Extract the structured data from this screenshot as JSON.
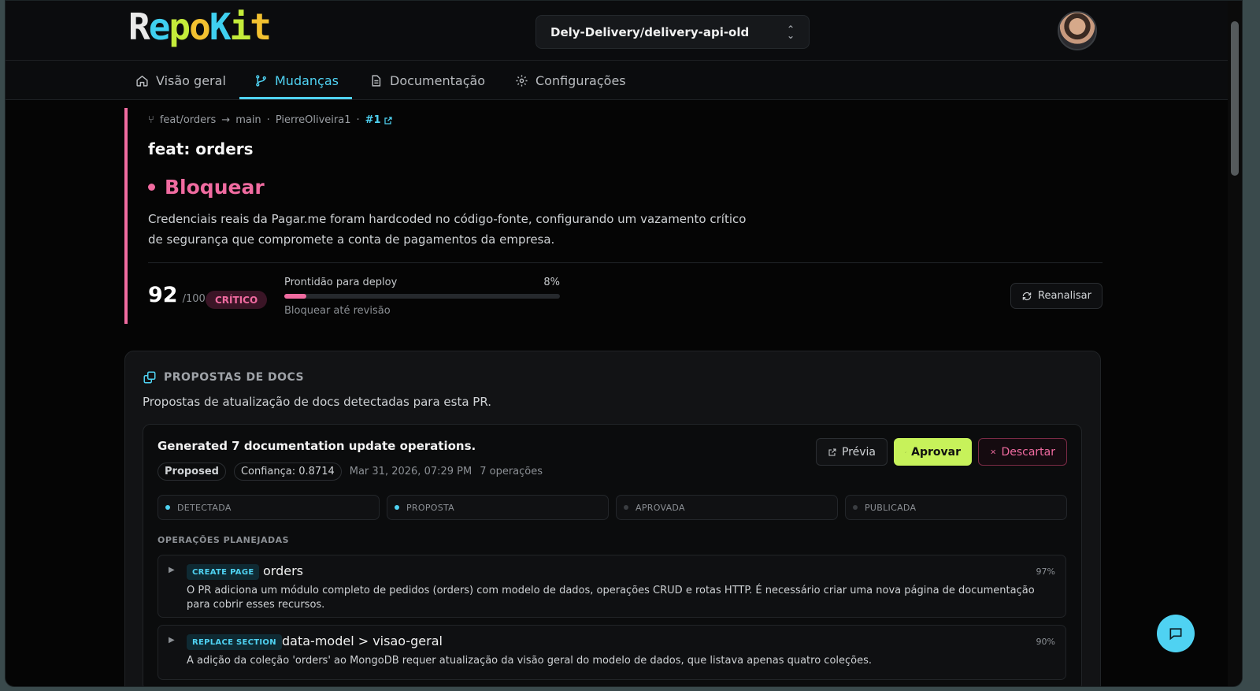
{
  "app": {
    "logo_text": "RepoKit"
  },
  "header": {
    "repo_selector": "Dely-Delivery/delivery-api-old"
  },
  "tabs": [
    {
      "label": "Visão geral",
      "icon": "home-icon"
    },
    {
      "label": "Mudanças",
      "icon": "git-branch-icon",
      "active": true
    },
    {
      "label": "Documentação",
      "icon": "document-icon"
    },
    {
      "label": "Configurações",
      "icon": "gear-icon"
    }
  ],
  "pr": {
    "source_branch": "feat/orders",
    "target_branch": "main",
    "author": "PierreOliveira1",
    "number": "#1",
    "title": "feat: orders",
    "verdict": "Bloquear",
    "verdict_description": "Credenciais reais da Pagar.me foram hardcoded no código-fonte, configurando um vazamento crítico de segurança que compromete a conta de pagamentos da empresa.",
    "score": "92",
    "score_max": "/100",
    "severity": "CRÍTICO",
    "deploy_label": "Prontidão para deploy",
    "deploy_percent": "8%",
    "deploy_fraction": 0.08,
    "deploy_note": "Bloquear até revisão",
    "reanalyze_label": "Reanalisar",
    "accent_color": "#f06ba0"
  },
  "docs": {
    "heading": "PROPOSTAS DE DOCS",
    "subtitle": "Propostas de atualização de docs detectadas para esta PR.",
    "operation": {
      "title": "Generated 7 documentation update operations.",
      "status": "Proposed",
      "confidence": "Confiança: 0.8714",
      "timestamp": "Mar 31, 2026, 07:29 PM",
      "count": "7 operações",
      "preview_label": "Prévia",
      "approve_label": "Aprovar",
      "discard_label": "Descartar"
    },
    "stages": [
      {
        "label": "DETECTADA",
        "done": true
      },
      {
        "label": "PROPOSTA",
        "done": true
      },
      {
        "label": "APROVADA",
        "done": false
      },
      {
        "label": "PUBLICADA",
        "done": false
      }
    ],
    "planned_heading": "OPERAÇÕES PLANEJADAS",
    "planned_ops": [
      {
        "tag": "CREATE PAGE",
        "name": "orders",
        "percent": "97%",
        "description": "O PR adiciona um módulo completo de pedidos (orders) com modelo de dados, operações CRUD e rotas HTTP. É necessário criar uma nova página de documentação para cobrir esses recursos."
      },
      {
        "tag": "REPLACE SECTION",
        "name": "data-model > visao-geral",
        "percent": "90%",
        "description": "A adição da coleção 'orders' ao MongoDB requer atualização da visão geral do modelo de dados, que listava apenas quatro coleções."
      }
    ]
  },
  "colors": {
    "accent_cyan": "#4fd2f2",
    "accent_lime": "#c7f25a",
    "danger_pink": "#f06ba0"
  }
}
